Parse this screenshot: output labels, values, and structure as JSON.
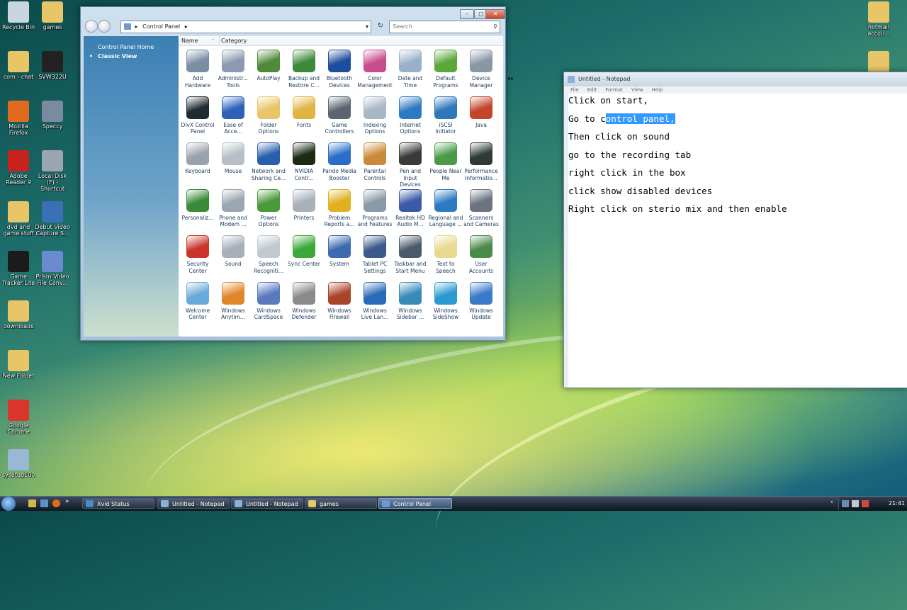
{
  "desktop": {
    "icons_left": [
      {
        "label": "Recycle Bin",
        "color": "#c9d6e0"
      },
      {
        "label": "com - chat",
        "color": "#e8c566"
      },
      {
        "label": "Mozilla Firefox",
        "color": "#e06a1e"
      },
      {
        "label": "Adobe Reader 9",
        "color": "#c8231a"
      },
      {
        "label": "dvd and game stuff",
        "color": "#e8c566"
      },
      {
        "label": "Game Tracker Lite",
        "color": "#1b1b1b"
      },
      {
        "label": "downloads",
        "color": "#e8c566"
      },
      {
        "label": "New Folder",
        "color": "#e8c566"
      },
      {
        "label": "Google Chrome",
        "color": "#d9352b"
      },
      {
        "label": "sysetup100",
        "color": "#9bb7d6"
      }
    ],
    "icons_second": [
      {
        "label": "games",
        "color": "#e8c566"
      },
      {
        "label": "SVW322U",
        "color": "#222222"
      },
      {
        "label": "Speccy",
        "color": "#7a8aa0"
      },
      {
        "label": "Local Disk (F) - Shortcut",
        "color": "#9aa5b1"
      },
      {
        "label": "Debut Video Capture S...",
        "color": "#3b6fb6"
      },
      {
        "label": "Prism Video File Conv...",
        "color": "#6a8ccf"
      }
    ],
    "icons_right": [
      {
        "label": "hotmail accou...",
        "color": "#e8c566"
      },
      {
        "label": "",
        "color": "#e8c566"
      }
    ]
  },
  "control_panel": {
    "breadcrumb_arrow": "▸",
    "address": "Control Panel",
    "search_placeholder": "Search",
    "sidebar": {
      "home": "Control Panel Home",
      "classic": "Classic View"
    },
    "columns": {
      "name": "Name",
      "category": "Category"
    },
    "items": [
      {
        "label": "Add Hardware",
        "color": "#7a8da3"
      },
      {
        "label": "Administr... Tools",
        "color": "#8a9ab0"
      },
      {
        "label": "AutoPlay",
        "color": "#4f8a3a"
      },
      {
        "label": "Backup and Restore C...",
        "color": "#3d8a3d"
      },
      {
        "label": "Bluetooth Devices",
        "color": "#1d4e9c"
      },
      {
        "label": "Color Management",
        "color": "#c94d8c"
      },
      {
        "label": "Date and Time",
        "color": "#9ab0c9"
      },
      {
        "label": "Default Programs",
        "color": "#5aa83c"
      },
      {
        "label": "Device Manager",
        "color": "#8a96a4"
      },
      {
        "label": "DivX Control Panel",
        "color": "#1f2a33"
      },
      {
        "label": "Ease of Acce...",
        "color": "#2d62b8"
      },
      {
        "label": "Folder Options",
        "color": "#e8c566"
      },
      {
        "label": "Fonts",
        "color": "#e0b440"
      },
      {
        "label": "Game Controllers",
        "color": "#5b6470"
      },
      {
        "label": "Indexing Options",
        "color": "#a9b6c4"
      },
      {
        "label": "Internet Options",
        "color": "#2e7ac2"
      },
      {
        "label": "iSCSI Initiator",
        "color": "#2c78b8"
      },
      {
        "label": "Java",
        "color": "#c4442a"
      },
      {
        "label": "Keyboard",
        "color": "#9aa3ad"
      },
      {
        "label": "Mouse",
        "color": "#b7bec6"
      },
      {
        "label": "Network and Sharing Ce...",
        "color": "#2a5fb0"
      },
      {
        "label": "NVIDIA Contr...",
        "color": "#1b2a12"
      },
      {
        "label": "Pando Media Booster",
        "color": "#2a6ec9"
      },
      {
        "label": "Parental Controls",
        "color": "#c98a3a"
      },
      {
        "label": "Pen and Input Devices",
        "color": "#3a3a3a"
      },
      {
        "label": "People Near Me",
        "color": "#4a9a4a"
      },
      {
        "label": "Performance Informatio...",
        "color": "#2e3a35"
      },
      {
        "label": "Personaliz...",
        "color": "#3a8a3a"
      },
      {
        "label": "Phone and Modem ...",
        "color": "#9aa6b2"
      },
      {
        "label": "Power Options",
        "color": "#4a9a3a"
      },
      {
        "label": "Printers",
        "color": "#a8b1ba"
      },
      {
        "label": "Problem Reports a...",
        "color": "#e0b020"
      },
      {
        "label": "Programs and Features",
        "color": "#8a9aa8"
      },
      {
        "label": "Realtek HD Audio M...",
        "color": "#3a5aa8"
      },
      {
        "label": "Regional and Language ...",
        "color": "#2e7ac2"
      },
      {
        "label": "Scanners and Cameras",
        "color": "#6b7480"
      },
      {
        "label": "Security Center",
        "color": "#c9352a"
      },
      {
        "label": "Sound",
        "color": "#a7afb8"
      },
      {
        "label": "Speech Recogniti...",
        "color": "#c2c8cf"
      },
      {
        "label": "Sync Center",
        "color": "#3aa83a"
      },
      {
        "label": "System",
        "color": "#3a6ab0"
      },
      {
        "label": "Tablet PC Settings",
        "color": "#3a5a8a"
      },
      {
        "label": "Taskbar and Start Menu",
        "color": "#4a5a6a"
      },
      {
        "label": "Text to Speech",
        "color": "#e8d890"
      },
      {
        "label": "User Accounts",
        "color": "#4a8a4a"
      },
      {
        "label": "Welcome Center",
        "color": "#6aaad8"
      },
      {
        "label": "Windows Anytim...",
        "color": "#e0862a"
      },
      {
        "label": "Windows CardSpace",
        "color": "#5a7ac0"
      },
      {
        "label": "Windows Defender",
        "color": "#8a8a8a"
      },
      {
        "label": "Windows Firewall",
        "color": "#a8442a"
      },
      {
        "label": "Windows Live Lan...",
        "color": "#2a6ab8"
      },
      {
        "label": "Windows Sidebar ...",
        "color": "#3a8ab8"
      },
      {
        "label": "Windows SideShow",
        "color": "#2a9ad0"
      },
      {
        "label": "Windows Update",
        "color": "#3a7ac8"
      }
    ]
  },
  "notepad": {
    "title": "Untitled - Notepad",
    "menu": [
      "File",
      "Edit",
      "Format",
      "View",
      "Help"
    ],
    "lines": [
      {
        "before": "Click on start,",
        "selected": "",
        "after": ""
      },
      {
        "before": "Go to c",
        "selected": "ontrol panel,",
        "after": ""
      },
      {
        "before": "Then click on sound",
        "selected": "",
        "after": ""
      },
      {
        "before": "go to the recording tab",
        "selected": "",
        "after": ""
      },
      {
        "before": "right click in the box",
        "selected": "",
        "after": ""
      },
      {
        "before": "click show disabled devices",
        "selected": "",
        "after": ""
      },
      {
        "before": "Right click on sterio mix and then enable",
        "selected": "",
        "after": ""
      }
    ]
  },
  "taskbar": {
    "buttons": [
      {
        "label": "Xvid Status",
        "color": "#4a8ac8",
        "active": false
      },
      {
        "label": "Untitled - Notepad",
        "color": "#8ab0d8",
        "active": false
      },
      {
        "label": "Untitled - Notepad",
        "color": "#8ab0d8",
        "active": false
      },
      {
        "label": "games",
        "color": "#e8c566",
        "active": false
      },
      {
        "label": "Control Panel",
        "color": "#6a9ad0",
        "active": true
      }
    ],
    "clock": "21:41"
  }
}
